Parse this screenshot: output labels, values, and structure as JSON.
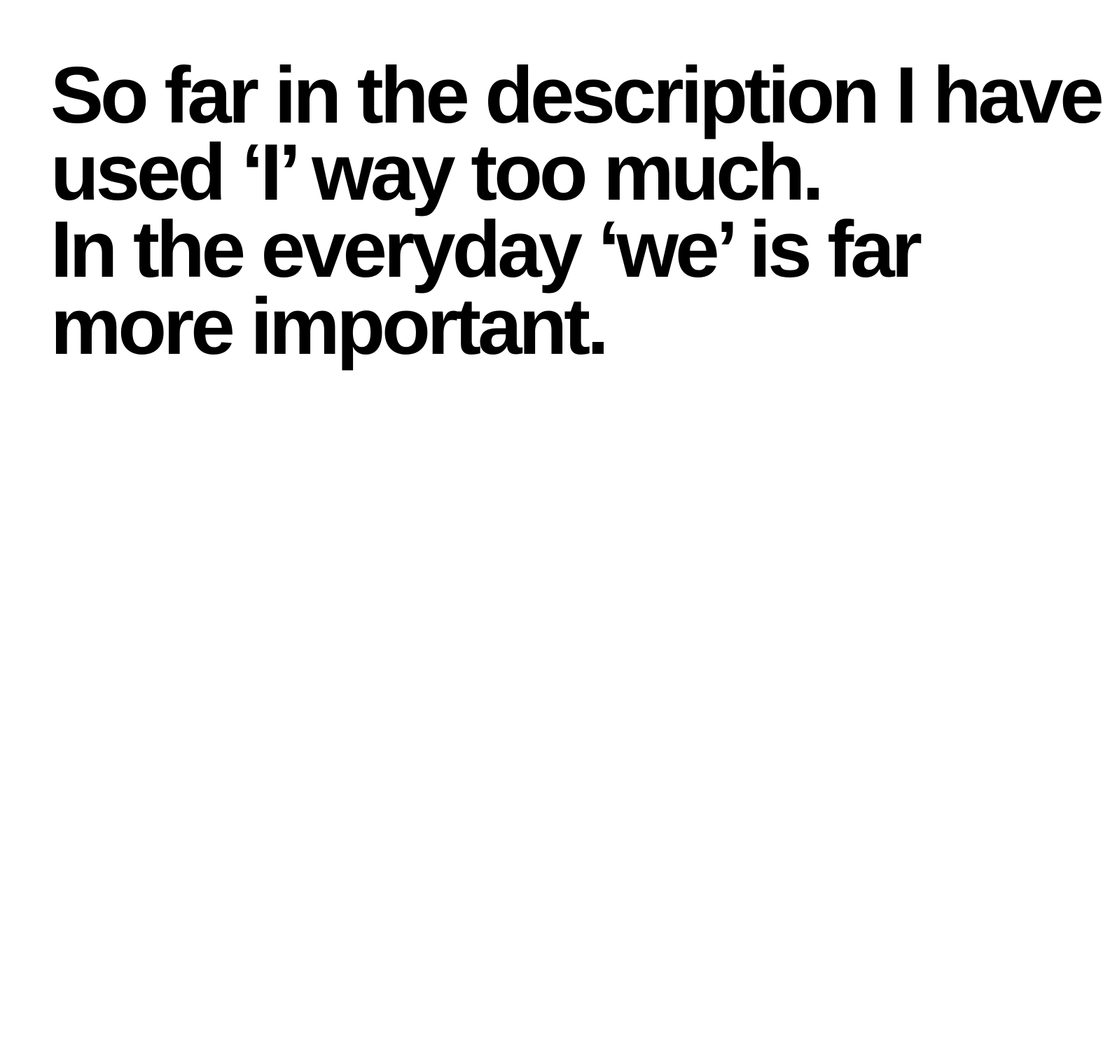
{
  "statement": {
    "lines": [
      "So far in the description I have",
      "used ‘I’ way too much.",
      "In the everyday ‘we’ is far",
      "more important."
    ]
  },
  "colors": {
    "background": "#ffffff",
    "text": "#000000"
  }
}
